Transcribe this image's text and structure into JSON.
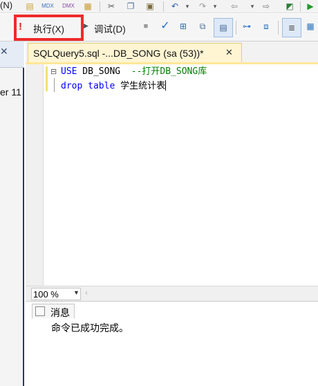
{
  "menu": {
    "partial_label": "(N)"
  },
  "toolbar": {
    "execute_label": "执行(X)",
    "debug_label": "调试(D)",
    "highlight_color": "#ee2b2b"
  },
  "object_explorer": {
    "truncated_label": "er 11"
  },
  "tab": {
    "title": "SQLQuery5.sql -...DB_SONG (sa (53))*",
    "close_glyph": "✕"
  },
  "editor": {
    "lines": [
      {
        "keyword": "USE",
        "rest": " DB_SONG  ",
        "comment": "--打开DB_SONG库",
        "fold": "⊟"
      },
      {
        "keyword": "drop table",
        "rest": " 学生统计表"
      }
    ]
  },
  "zoom": {
    "value": "100 %"
  },
  "messages": {
    "tab_label": "消息",
    "text": "命令已成功完成。"
  }
}
